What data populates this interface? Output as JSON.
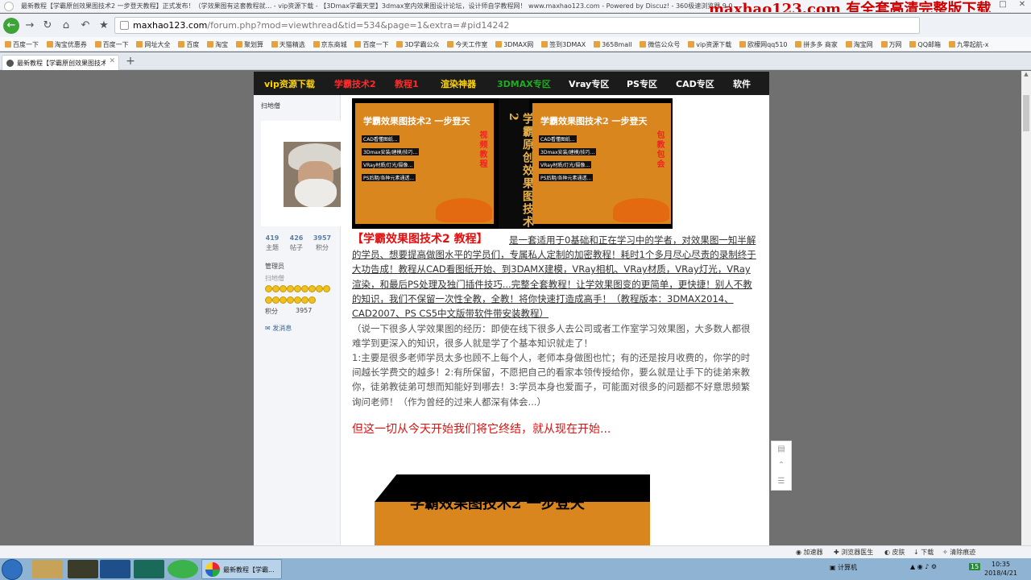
{
  "window": {
    "title": "最新教程【学霸原创效果图技术2 一步登天教程】正式发布！（学效果图有这套教程就... - vip资源下载 - 【3Dmax学霸天堂】3dmax室内效果图设计论坛，设计师自学教程网！ www.maxhao123.com - Powered by Discuz! - 360极速浏览器 9.0",
    "watermark": "maxhao123.com 有全套高清完整版下载"
  },
  "address_bar": {
    "host": "maxhao123.com",
    "path": "/forum.php?mod=viewthread&tid=534&page=1&extra=#pid14242"
  },
  "bookmarks": [
    "百度一下",
    "淘宝优惠券",
    "百度一下",
    "网址大全",
    "百度",
    "淘宝",
    "聚划算",
    "天猫精选",
    "京东商城",
    "百度一下",
    "3D学霸公众",
    "今天工作室",
    "3DMAX网",
    "签到3DMAX",
    "3658mall",
    "微信公众号",
    "vip资源下载",
    "欧檬网qq510",
    "拼多多 商家",
    "淘宝网",
    "万网",
    "QQ邮箱",
    "九零起航-x"
  ],
  "tab": {
    "label": "最新教程【学霸原创效果图技术..."
  },
  "site_nav": [
    {
      "label": "vip资源下载",
      "color": "#ffd400"
    },
    {
      "label": "学霸技术2",
      "color": "#ff2a2a"
    },
    {
      "label": "教程1",
      "color": "#ff2a2a"
    },
    {
      "label": "渲染神器",
      "color": "#ffd400"
    },
    {
      "label": "3DMAX专区",
      "color": "#22aa22"
    },
    {
      "label": "Vray专区",
      "color": "#ffffff"
    },
    {
      "label": "PS专区",
      "color": "#ffffff"
    },
    {
      "label": "CAD专区",
      "color": "#ffffff"
    },
    {
      "label": "软件",
      "color": "#ffffff"
    }
  ],
  "user": {
    "name": "扫地僧",
    "stats": [
      {
        "value": "419",
        "label": "主题"
      },
      {
        "value": "426",
        "label": "帖子"
      },
      {
        "value": "3957",
        "label": "积分"
      }
    ],
    "role": "管理员",
    "rank": "扫地僧",
    "points_label": "积分",
    "points": "3957",
    "message": "发消息"
  },
  "product_box": {
    "header": "学霸效果图技术2 一步登天",
    "lines": [
      "CAD看懂图纸...",
      "3Dmax安装/建模/技巧...",
      "VRay材质/灯光/摄像...",
      "PS后期/各种元素通透..."
    ],
    "spine": "学霸原创效果图技术2",
    "side1": "视频教程",
    "side2": "包教包会"
  },
  "post": {
    "title": "【学霸效果图技术2 教程】",
    "para1": "是一套适用于0基础和正在学习中的学者，对效果图一知半解的学员、想要提高做图水平的学员们，专属私人定制的加密教程！耗时1个多月尽心尽责的录制终于大功告成！教程从CAD看图纸开始、到3DAMX建模，VRay相机、VRay材质，VRay灯光，VRay渲染，和最后PS处理及独门插件技巧...完整全套教程！让学效果图变的更简单，更快捷！别人不教的知识，我们不保留一次性全教，全教！将你快速打造成高手！（教程版本：3DMAX2014、CAD2007、PS CS5中文版带软件带安装教程）",
    "para2": "（说一下很多人学效果图的经历：即使在线下很多人去公司或者工作室学习效果图，大多数人都很难学到更深入的知识，很多人就是学了个基本知识就走了！",
    "para3": "1:主要是很多老师学员太多也顾不上每个人，老师本身做图也忙；有的还是按月收费的，你学的时间越长学费交的越多！2:有所保留，不愿把自己的看家本领传授给你，要么就是让手下的徒弟来教你，徒弟教徒弟可想而知能好到哪去！3:学员本身也爱面子，可能面对很多的问题都不好意思频繁询问老师！（作为曾经的过来人都深有体会...）",
    "slogan": "但这一切从今天开始我们将它终结，就从现在开始...",
    "big_box_title": "学霸效果图技术2 一步登天"
  },
  "status_bar": [
    "加速器",
    "浏览器医生",
    "皮肤",
    "下载",
    "清除痕迹"
  ],
  "taskbar": {
    "active_label": "最新教程【学霸...",
    "tray_label": "计算机",
    "time": "10:35",
    "date": "2018/4/21",
    "badge": "15"
  }
}
